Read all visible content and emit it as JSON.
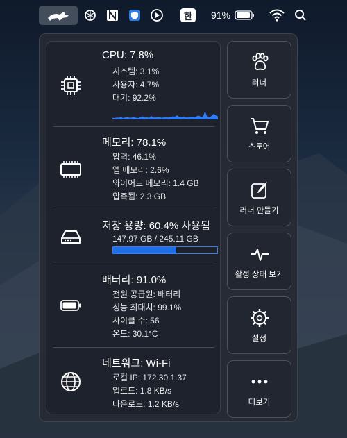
{
  "menubar": {
    "battery_percent": "91%",
    "input_source": "한"
  },
  "cpu": {
    "title": "CPU:  7.8%",
    "lines": [
      "시스템:  3.1%",
      "사용자:  4.7%",
      "대기:  92.2%"
    ],
    "graph_color": "#2f7bf5",
    "graph_values": [
      0.12,
      0.1,
      0.14,
      0.12,
      0.18,
      0.1,
      0.15,
      0.16,
      0.12,
      0.14,
      0.2,
      0.12,
      0.1,
      0.18,
      0.22,
      0.14,
      0.16,
      0.12,
      0.25,
      0.15,
      0.14,
      0.18,
      0.16,
      0.12,
      0.15,
      0.2,
      0.14,
      0.18,
      0.22,
      0.2,
      0.3,
      0.18,
      0.16,
      0.22,
      0.15,
      0.14,
      0.18,
      0.2,
      0.16,
      0.22,
      0.28,
      0.2,
      0.18,
      0.6,
      0.2,
      0.15,
      0.25,
      0.4,
      0.3,
      0.22
    ]
  },
  "memory": {
    "title": "메모리: 78.1%",
    "lines": [
      "압력:  46.1%",
      "앱 메모리:   2.6%",
      "와이어드 메모리:   1.4 GB",
      "압축됨:   2.3 GB"
    ]
  },
  "storage": {
    "title": "저장 용량: 60.4% 사용됨",
    "detail": "147.97 GB / 245.11 GB",
    "used_fraction": 0.604,
    "bar_color": "#1f6fe6"
  },
  "battery": {
    "title": "배터리:  91.0%",
    "lines": [
      "전원 공급원:  배터리",
      "성능 최대치:   99.1%",
      "사이클 수:  56",
      "온도:  30.1°C"
    ]
  },
  "network": {
    "title": "네트워크: Wi-Fi",
    "lines": [
      "로컬 IP:  172.30.1.37",
      "업로드:    1.8 KB/s",
      "다운로드:    1.2 KB/s"
    ]
  },
  "buttons": [
    {
      "label": "러너",
      "icon": "paw-icon"
    },
    {
      "label": "스토어",
      "icon": "cart-icon"
    },
    {
      "label": "러너 만들기",
      "icon": "edit-icon"
    },
    {
      "label": "활성 상태 보기",
      "icon": "activity-icon"
    },
    {
      "label": "설정",
      "icon": "gear-icon"
    },
    {
      "label": "더보기",
      "icon": "more-icon"
    }
  ]
}
